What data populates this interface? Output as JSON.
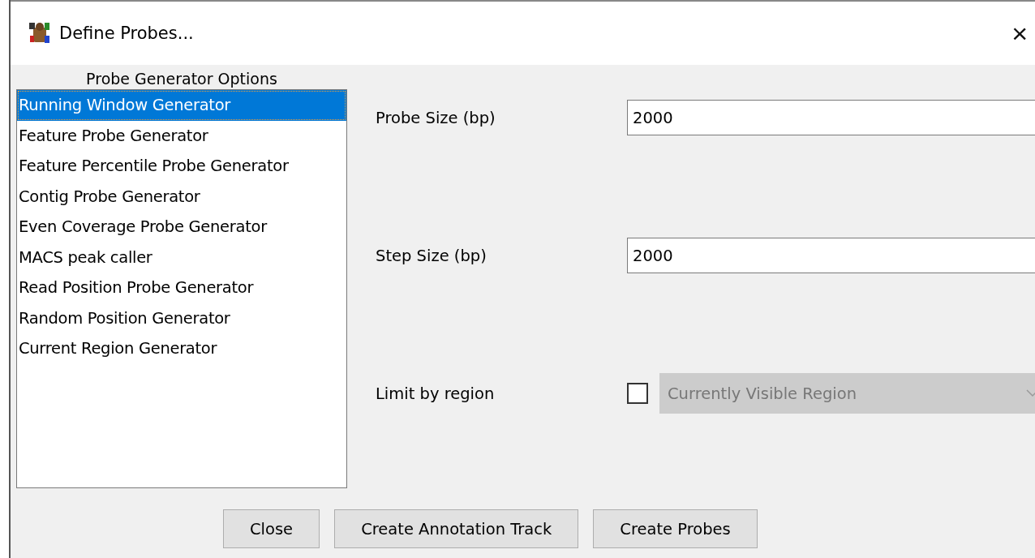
{
  "window": {
    "title": "Define Probes...",
    "close": "×"
  },
  "generator_list": {
    "heading": "Probe Generator Options",
    "items": [
      {
        "label": "Running Window Generator",
        "selected": true
      },
      {
        "label": "Feature Probe Generator",
        "selected": false
      },
      {
        "label": "Feature Percentile Probe Generator",
        "selected": false
      },
      {
        "label": "Contig Probe Generator",
        "selected": false
      },
      {
        "label": "Even Coverage Probe Generator",
        "selected": false
      },
      {
        "label": "MACS peak caller",
        "selected": false
      },
      {
        "label": "Read Position Probe Generator",
        "selected": false
      },
      {
        "label": "Random Position Generator",
        "selected": false
      },
      {
        "label": "Current Region Generator",
        "selected": false
      }
    ]
  },
  "options": [
    {
      "kind": "text",
      "label": "Probe Size (bp)",
      "value": "2000"
    },
    {
      "kind": "text",
      "label": "Step Size (bp)",
      "value": "2000"
    },
    {
      "kind": "region",
      "label": "Limit by region",
      "checked": false,
      "value": "Currently Visible Region",
      "disabled": true
    }
  ],
  "buttons": [
    "Close",
    "Create Annotation Track",
    "Create Probes"
  ]
}
